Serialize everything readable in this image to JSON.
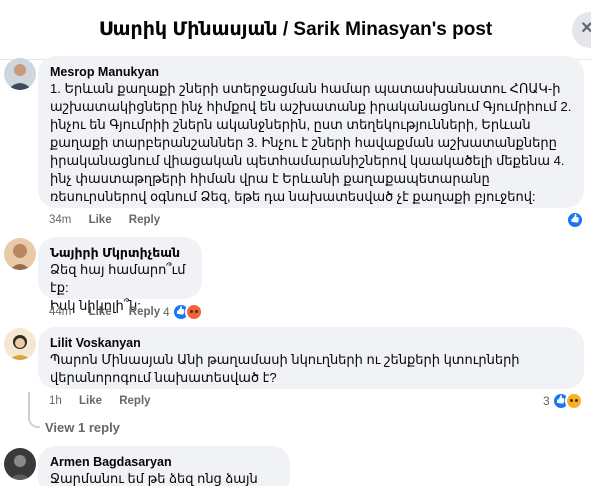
{
  "header": {
    "title": "Սարիկ Մինասյան / Sarik Minasyan's post",
    "close_icon": "×"
  },
  "comments": [
    {
      "author": "Mesrop Manukyan",
      "text": "1. Երևան քաղաքի շների ստերջացման համար պատասխանատու ՀՈԱԿ-ի աշխատակիցները ինչ հիմքով են աշխատանք իրականացնում Գյումրիում 2. ինչու են Գյումրիի շներն ականջներին, ըստ տեղեկությունների, Երևան քաղաքի տարբերանշաններ 3. Ինչու է շների հավաքման աշխատանքները իրականացնում վիացական պետհամարանիշներով կաակածելի մեքենա 4. ինչ փաստաթղթերի հիման վրա է Երևանի քաղաքապետարանը ռեսուրսներով օգնում Ձեզ, եթե դա նախատեսված չէ քաղաքի բյուջեով:",
      "time": "34m",
      "like": "Like",
      "reply": "Reply"
    },
    {
      "author": "Նայիրի Մկրտիչեան",
      "lines": [
        "Ձեզ հայ համարո՞ւմ էք:",
        "Իսկ նիկոլի՞ն:"
      ],
      "time": "44m",
      "like": "Like",
      "reply": "Reply",
      "reactions": "4"
    },
    {
      "author": "Lilit Voskanyan",
      "text": "Պարոն Մինասյան Անի թաղամասի նկուղների ու շենքերի կտուրների վերանորոգում նախատեսված է?",
      "time": "1h",
      "like": "Like",
      "reply": "Reply",
      "reactions": "3"
    },
    {
      "author": "Armen Bagdasaryan",
      "text": "Ջարմանու եմ թե ձեզ ոնց ձայն կտան"
    }
  ],
  "view_reply": "View 1 reply",
  "colors": {
    "like_blue": "#1877f2",
    "bubble_bg": "#f0f2f5",
    "meta_gray": "#65676b"
  }
}
